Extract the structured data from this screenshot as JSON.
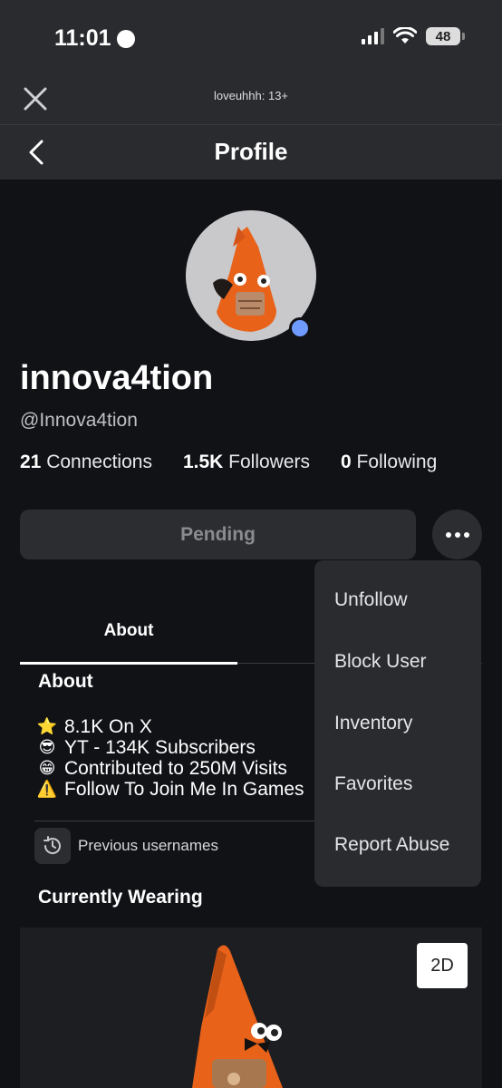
{
  "status_bar": {
    "time": "11:01",
    "battery": "48"
  },
  "topbar": {
    "title": "loveuhhh: 13+"
  },
  "navbar": {
    "title": "Profile"
  },
  "profile": {
    "display_name": "innova4tion",
    "username": "@Innova4tion",
    "stats": [
      {
        "count": "21",
        "label": "Connections"
      },
      {
        "count": "1.5K",
        "label": "Followers"
      },
      {
        "count": "0",
        "label": "Following"
      }
    ],
    "pending_label": "Pending"
  },
  "tabs": {
    "about": "About"
  },
  "about": {
    "heading": "About",
    "bio": [
      {
        "emoji": "⭐",
        "text": "8.1K On X"
      },
      {
        "emoji": "😎",
        "text": "YT - 134K Subscribers"
      },
      {
        "emoji": "😁",
        "text": "Contributed to 250M Visits"
      },
      {
        "emoji": "⚠️",
        "text": "Follow To Join Me In Games"
      }
    ],
    "previous_usernames": "Previous usernames"
  },
  "wearing": {
    "heading": "Currently Wearing",
    "toggle_label": "2D"
  },
  "menu": {
    "items": [
      "Unfollow",
      "Block User",
      "Inventory",
      "Favorites",
      "Report Abuse"
    ]
  },
  "colors": {
    "online": "#6f9bff",
    "avatar_orange": "#e8621a",
    "background": "#111216",
    "panel": "#2a2b2e"
  }
}
